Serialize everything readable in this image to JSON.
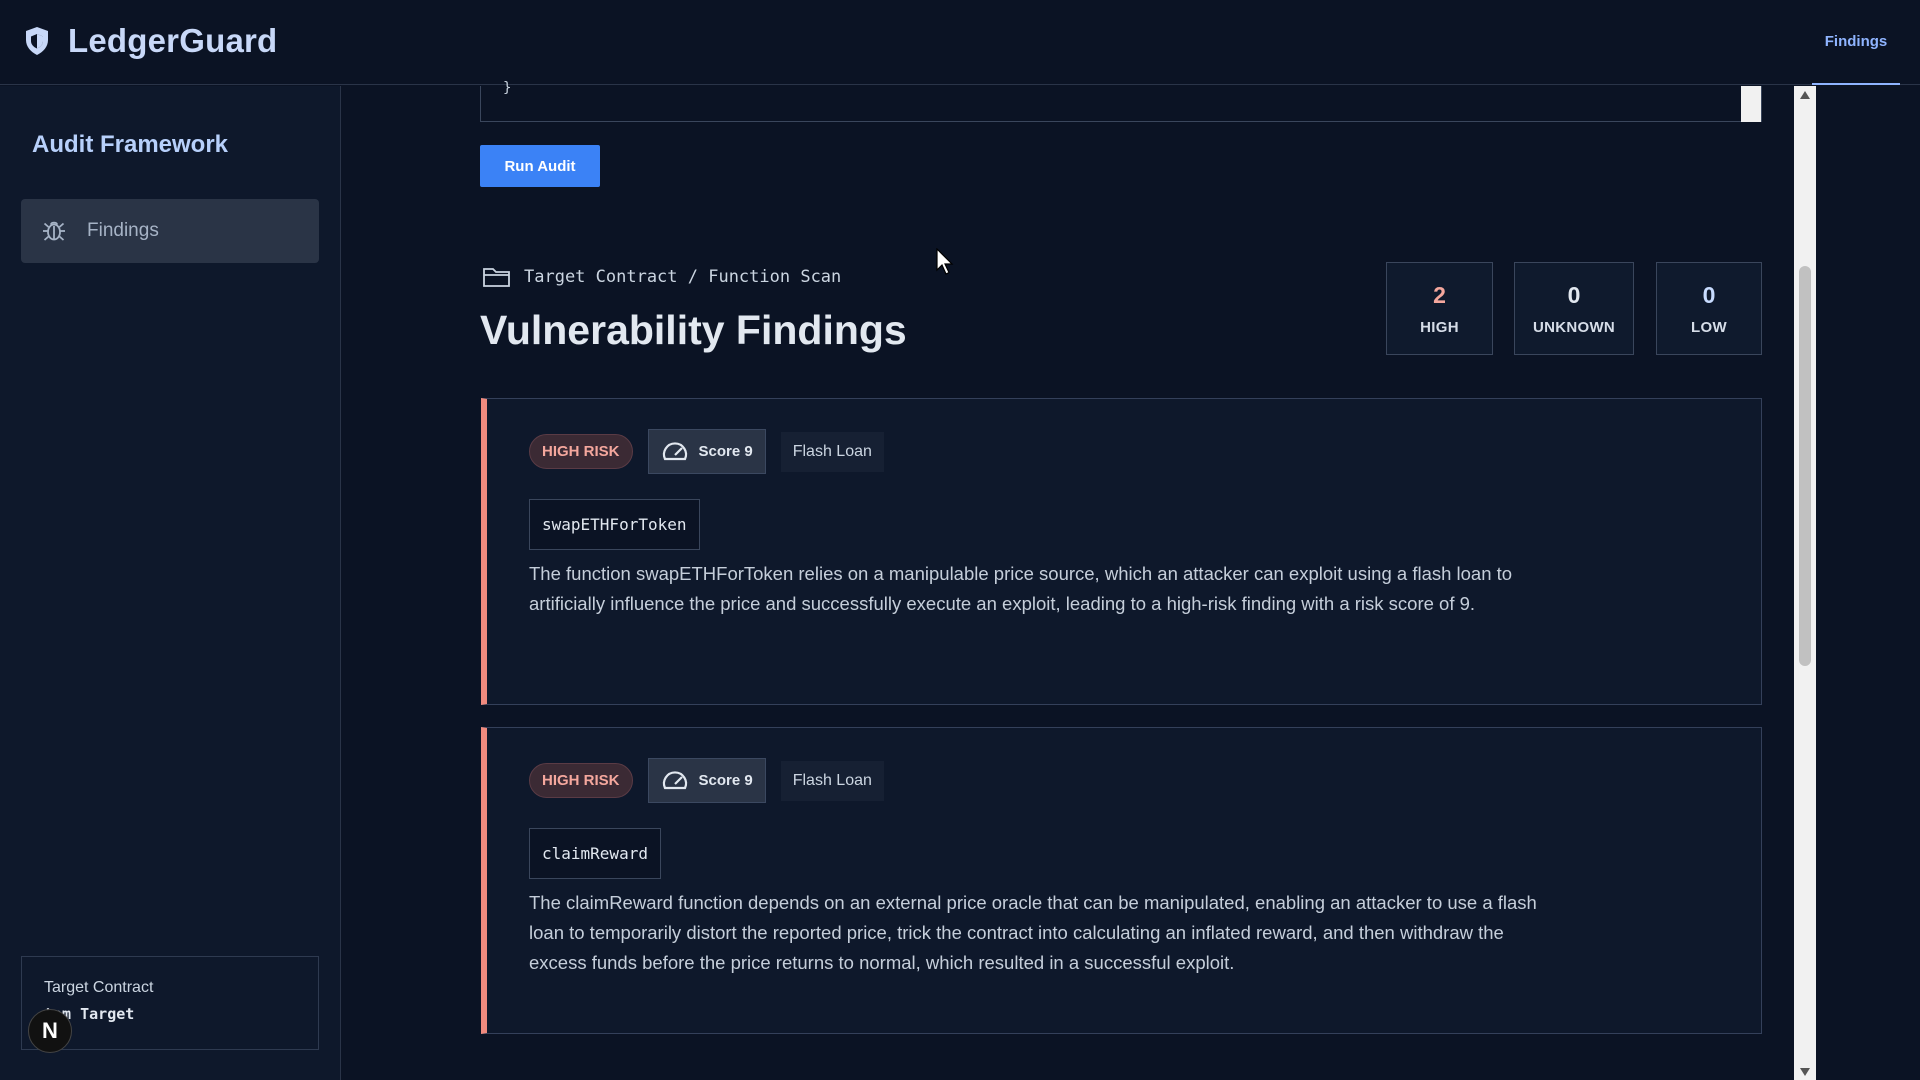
{
  "app": {
    "name": "LedgerGuard",
    "nav_active": "Findings"
  },
  "sidebar": {
    "title": "Audit Framework",
    "items": [
      {
        "label": "Findings",
        "icon": "bug-icon"
      }
    ],
    "target": {
      "label": "Target Contract",
      "value": "tom Target"
    },
    "avatar_letter": "N"
  },
  "editor": {
    "visible_code": "}"
  },
  "toolbar": {
    "run_label": "Run Audit"
  },
  "header": {
    "breadcrumb": "Target Contract / Function Scan",
    "title": "Vulnerability Findings"
  },
  "stats": [
    {
      "value": "2",
      "label": "HIGH",
      "color": "#f4a79d"
    },
    {
      "value": "0",
      "label": "UNKNOWN",
      "color": "#e2e8f0"
    },
    {
      "value": "0",
      "label": "LOW",
      "color": "#c8dcff"
    }
  ],
  "findings": [
    {
      "risk": "HIGH RISK",
      "score": "Score 9",
      "category": "Flash Loan",
      "function": "swapETHForToken",
      "description": "The function swapETHForToken relies on a manipulable price source, which an attacker can exploit using a flash loan to artificially influence the price and successfully execute an exploit, leading to a high-risk finding with a risk score of 9."
    },
    {
      "risk": "HIGH RISK",
      "score": "Score 9",
      "category": "Flash Loan",
      "function": "claimReward",
      "description": "The claimReward function depends on an external price oracle that can be manipulated, enabling an attacker to use a flash loan to temporarily distort the reported price, trick the contract into calculating an inflated reward, and then withdraw the excess funds before the price returns to normal, which resulted in a successful exploit."
    }
  ],
  "colors": {
    "accent": "#3b82f6",
    "high": "#f08a7e",
    "background": "#0b1324"
  }
}
